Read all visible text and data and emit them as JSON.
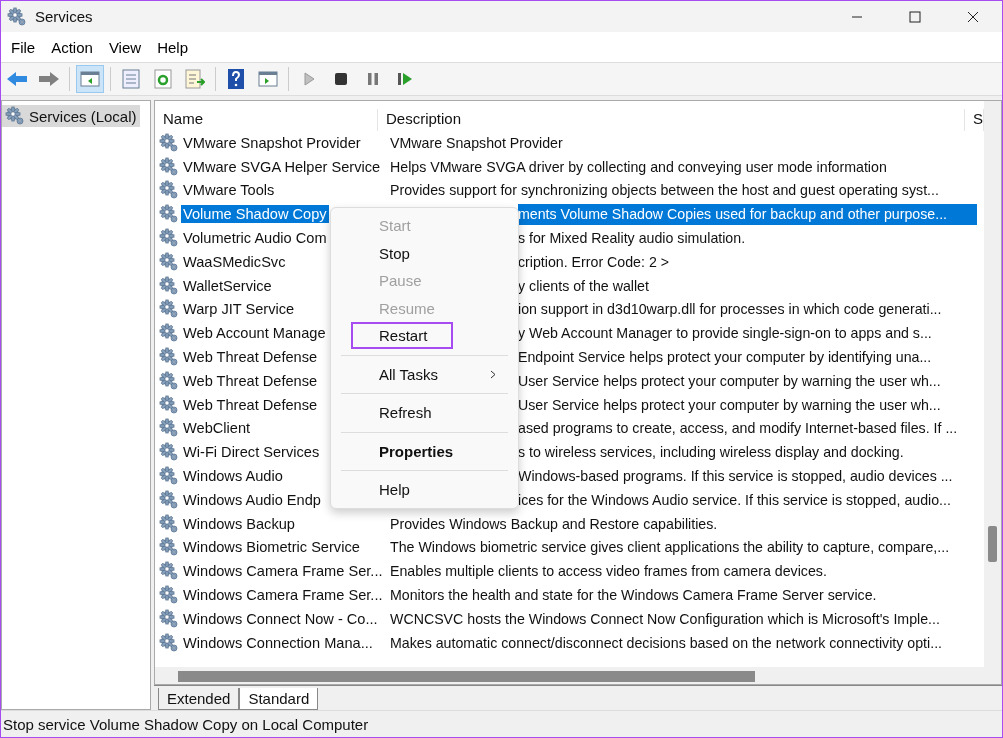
{
  "window": {
    "title": "Services"
  },
  "menu_bar": [
    "File",
    "Action",
    "View",
    "Help"
  ],
  "tree": {
    "items": [
      {
        "label": "Services (Local)",
        "selected": true
      }
    ]
  },
  "table": {
    "columns": [
      "Name",
      "Description",
      "S"
    ],
    "rows": [
      {
        "name": "VMware Snapshot Provider",
        "description": "VMware Snapshot Provider",
        "selected": false,
        "kind": "plain"
      },
      {
        "name": "VMware SVGA Helper Service",
        "description": "Helps VMware SVGA driver by collecting and conveying user mode information",
        "selected": false,
        "kind": "plain"
      },
      {
        "name": "VMware Tools",
        "description": "Provides support for synchronizing objects between the host and guest operating syst...",
        "selected": false,
        "kind": "plain"
      },
      {
        "name": "Volume Shadow Copy",
        "description": "ments Volume Shadow Copies used for backup and other purpose...",
        "selected": true,
        "kind": "covered"
      },
      {
        "name": "Volumetric Audio Com",
        "description": "s for Mixed Reality audio simulation.",
        "selected": false,
        "kind": "covered"
      },
      {
        "name": "WaaSMedicSvc",
        "description": "cription. Error Code: 2 >",
        "selected": false,
        "kind": "covered"
      },
      {
        "name": "WalletService",
        "description": "y clients of the wallet",
        "selected": false,
        "kind": "covered"
      },
      {
        "name": "Warp JIT Service",
        "description": "ion support in d3d10warp.dll for processes in which code generati...",
        "selected": false,
        "kind": "covered"
      },
      {
        "name": "Web Account Manage",
        "description": "y Web Account Manager to provide single-sign-on to apps and s...",
        "selected": false,
        "kind": "covered"
      },
      {
        "name": "Web Threat Defense",
        "description": "Endpoint Service helps protect your computer by identifying una...",
        "selected": false,
        "kind": "covered"
      },
      {
        "name": "Web Threat Defense",
        "description": "User Service helps protect your computer by warning the user wh...",
        "selected": false,
        "kind": "covered"
      },
      {
        "name": "Web Threat Defense",
        "description": "User Service helps protect your computer by warning the user wh...",
        "selected": false,
        "kind": "covered"
      },
      {
        "name": "WebClient",
        "description": "ased programs to create, access, and modify Internet-based files. If ...",
        "selected": false,
        "kind": "covered"
      },
      {
        "name": "Wi-Fi Direct Services",
        "description": "s to wireless services, including wireless display and docking.",
        "selected": false,
        "kind": "covered"
      },
      {
        "name": "Windows Audio",
        "description": "Windows-based programs.  If this service is stopped, audio devices ...",
        "selected": false,
        "kind": "covered"
      },
      {
        "name": "Windows Audio Endp",
        "description": "ices for the Windows Audio service.  If this service is stopped, audio...",
        "selected": false,
        "kind": "covered"
      },
      {
        "name": "Windows Backup",
        "description": "Provides Windows Backup and Restore capabilities.",
        "selected": false,
        "kind": "plain"
      },
      {
        "name": "Windows Biometric Service",
        "description": "The Windows biometric service gives client applications the ability to capture, compare,...",
        "selected": false,
        "kind": "plain"
      },
      {
        "name": "Windows Camera Frame Ser...",
        "description": "Enables multiple clients to access video frames from camera devices.",
        "selected": false,
        "kind": "plain"
      },
      {
        "name": "Windows Camera Frame Ser...",
        "description": "Monitors the health and state for the Windows Camera Frame Server service.",
        "selected": false,
        "kind": "plain"
      },
      {
        "name": "Windows Connect Now - Co...",
        "description": "WCNCSVC hosts the Windows Connect Now Configuration which is Microsoft's Imple...",
        "selected": false,
        "kind": "plain"
      },
      {
        "name": "Windows Connection Mana...",
        "description": "Makes automatic connect/disconnect decisions based on the network connectivity opti...",
        "selected": false,
        "kind": "plain"
      }
    ]
  },
  "context_menu": [
    {
      "kind": "item",
      "label": "Start",
      "disabled": true
    },
    {
      "kind": "item",
      "label": "Stop",
      "disabled": false
    },
    {
      "kind": "item",
      "label": "Pause",
      "disabled": true
    },
    {
      "kind": "item",
      "label": "Resume",
      "disabled": true
    },
    {
      "kind": "item",
      "label": "Restart",
      "disabled": false,
      "highlighted": true
    },
    {
      "kind": "separator"
    },
    {
      "kind": "item",
      "label": "All Tasks",
      "disabled": false,
      "submenu": true
    },
    {
      "kind": "separator"
    },
    {
      "kind": "item",
      "label": "Refresh",
      "disabled": false
    },
    {
      "kind": "separator"
    },
    {
      "kind": "item",
      "label": "Properties",
      "disabled": false,
      "default": true
    },
    {
      "kind": "separator"
    },
    {
      "kind": "item",
      "label": "Help",
      "disabled": false
    }
  ],
  "view_tabs": [
    {
      "label": "Extended",
      "selected": false
    },
    {
      "label": "Standard",
      "selected": true
    }
  ],
  "status_bar": "Stop service Volume Shadow Copy on Local Computer"
}
